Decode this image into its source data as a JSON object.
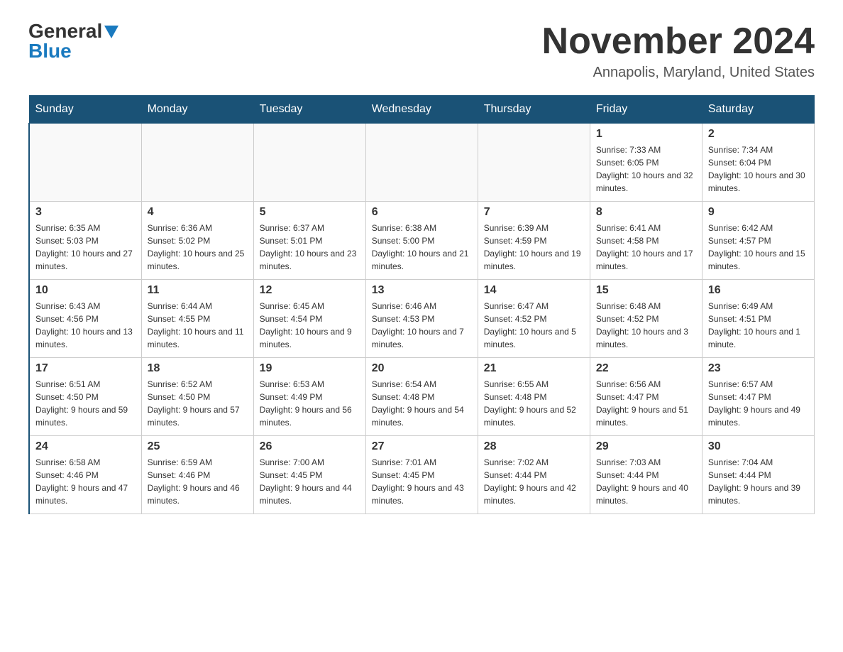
{
  "header": {
    "logo": {
      "general": "General",
      "blue": "Blue",
      "arrow": "▲"
    },
    "title": "November 2024",
    "location": "Annapolis, Maryland, United States"
  },
  "days_of_week": [
    "Sunday",
    "Monday",
    "Tuesday",
    "Wednesday",
    "Thursday",
    "Friday",
    "Saturday"
  ],
  "weeks": [
    [
      {
        "day": "",
        "sunrise": "",
        "sunset": "",
        "daylight": ""
      },
      {
        "day": "",
        "sunrise": "",
        "sunset": "",
        "daylight": ""
      },
      {
        "day": "",
        "sunrise": "",
        "sunset": "",
        "daylight": ""
      },
      {
        "day": "",
        "sunrise": "",
        "sunset": "",
        "daylight": ""
      },
      {
        "day": "",
        "sunrise": "",
        "sunset": "",
        "daylight": ""
      },
      {
        "day": "1",
        "sunrise": "Sunrise: 7:33 AM",
        "sunset": "Sunset: 6:05 PM",
        "daylight": "Daylight: 10 hours and 32 minutes."
      },
      {
        "day": "2",
        "sunrise": "Sunrise: 7:34 AM",
        "sunset": "Sunset: 6:04 PM",
        "daylight": "Daylight: 10 hours and 30 minutes."
      }
    ],
    [
      {
        "day": "3",
        "sunrise": "Sunrise: 6:35 AM",
        "sunset": "Sunset: 5:03 PM",
        "daylight": "Daylight: 10 hours and 27 minutes."
      },
      {
        "day": "4",
        "sunrise": "Sunrise: 6:36 AM",
        "sunset": "Sunset: 5:02 PM",
        "daylight": "Daylight: 10 hours and 25 minutes."
      },
      {
        "day": "5",
        "sunrise": "Sunrise: 6:37 AM",
        "sunset": "Sunset: 5:01 PM",
        "daylight": "Daylight: 10 hours and 23 minutes."
      },
      {
        "day": "6",
        "sunrise": "Sunrise: 6:38 AM",
        "sunset": "Sunset: 5:00 PM",
        "daylight": "Daylight: 10 hours and 21 minutes."
      },
      {
        "day": "7",
        "sunrise": "Sunrise: 6:39 AM",
        "sunset": "Sunset: 4:59 PM",
        "daylight": "Daylight: 10 hours and 19 minutes."
      },
      {
        "day": "8",
        "sunrise": "Sunrise: 6:41 AM",
        "sunset": "Sunset: 4:58 PM",
        "daylight": "Daylight: 10 hours and 17 minutes."
      },
      {
        "day": "9",
        "sunrise": "Sunrise: 6:42 AM",
        "sunset": "Sunset: 4:57 PM",
        "daylight": "Daylight: 10 hours and 15 minutes."
      }
    ],
    [
      {
        "day": "10",
        "sunrise": "Sunrise: 6:43 AM",
        "sunset": "Sunset: 4:56 PM",
        "daylight": "Daylight: 10 hours and 13 minutes."
      },
      {
        "day": "11",
        "sunrise": "Sunrise: 6:44 AM",
        "sunset": "Sunset: 4:55 PM",
        "daylight": "Daylight: 10 hours and 11 minutes."
      },
      {
        "day": "12",
        "sunrise": "Sunrise: 6:45 AM",
        "sunset": "Sunset: 4:54 PM",
        "daylight": "Daylight: 10 hours and 9 minutes."
      },
      {
        "day": "13",
        "sunrise": "Sunrise: 6:46 AM",
        "sunset": "Sunset: 4:53 PM",
        "daylight": "Daylight: 10 hours and 7 minutes."
      },
      {
        "day": "14",
        "sunrise": "Sunrise: 6:47 AM",
        "sunset": "Sunset: 4:52 PM",
        "daylight": "Daylight: 10 hours and 5 minutes."
      },
      {
        "day": "15",
        "sunrise": "Sunrise: 6:48 AM",
        "sunset": "Sunset: 4:52 PM",
        "daylight": "Daylight: 10 hours and 3 minutes."
      },
      {
        "day": "16",
        "sunrise": "Sunrise: 6:49 AM",
        "sunset": "Sunset: 4:51 PM",
        "daylight": "Daylight: 10 hours and 1 minute."
      }
    ],
    [
      {
        "day": "17",
        "sunrise": "Sunrise: 6:51 AM",
        "sunset": "Sunset: 4:50 PM",
        "daylight": "Daylight: 9 hours and 59 minutes."
      },
      {
        "day": "18",
        "sunrise": "Sunrise: 6:52 AM",
        "sunset": "Sunset: 4:50 PM",
        "daylight": "Daylight: 9 hours and 57 minutes."
      },
      {
        "day": "19",
        "sunrise": "Sunrise: 6:53 AM",
        "sunset": "Sunset: 4:49 PM",
        "daylight": "Daylight: 9 hours and 56 minutes."
      },
      {
        "day": "20",
        "sunrise": "Sunrise: 6:54 AM",
        "sunset": "Sunset: 4:48 PM",
        "daylight": "Daylight: 9 hours and 54 minutes."
      },
      {
        "day": "21",
        "sunrise": "Sunrise: 6:55 AM",
        "sunset": "Sunset: 4:48 PM",
        "daylight": "Daylight: 9 hours and 52 minutes."
      },
      {
        "day": "22",
        "sunrise": "Sunrise: 6:56 AM",
        "sunset": "Sunset: 4:47 PM",
        "daylight": "Daylight: 9 hours and 51 minutes."
      },
      {
        "day": "23",
        "sunrise": "Sunrise: 6:57 AM",
        "sunset": "Sunset: 4:47 PM",
        "daylight": "Daylight: 9 hours and 49 minutes."
      }
    ],
    [
      {
        "day": "24",
        "sunrise": "Sunrise: 6:58 AM",
        "sunset": "Sunset: 4:46 PM",
        "daylight": "Daylight: 9 hours and 47 minutes."
      },
      {
        "day": "25",
        "sunrise": "Sunrise: 6:59 AM",
        "sunset": "Sunset: 4:46 PM",
        "daylight": "Daylight: 9 hours and 46 minutes."
      },
      {
        "day": "26",
        "sunrise": "Sunrise: 7:00 AM",
        "sunset": "Sunset: 4:45 PM",
        "daylight": "Daylight: 9 hours and 44 minutes."
      },
      {
        "day": "27",
        "sunrise": "Sunrise: 7:01 AM",
        "sunset": "Sunset: 4:45 PM",
        "daylight": "Daylight: 9 hours and 43 minutes."
      },
      {
        "day": "28",
        "sunrise": "Sunrise: 7:02 AM",
        "sunset": "Sunset: 4:44 PM",
        "daylight": "Daylight: 9 hours and 42 minutes."
      },
      {
        "day": "29",
        "sunrise": "Sunrise: 7:03 AM",
        "sunset": "Sunset: 4:44 PM",
        "daylight": "Daylight: 9 hours and 40 minutes."
      },
      {
        "day": "30",
        "sunrise": "Sunrise: 7:04 AM",
        "sunset": "Sunset: 4:44 PM",
        "daylight": "Daylight: 9 hours and 39 minutes."
      }
    ]
  ]
}
